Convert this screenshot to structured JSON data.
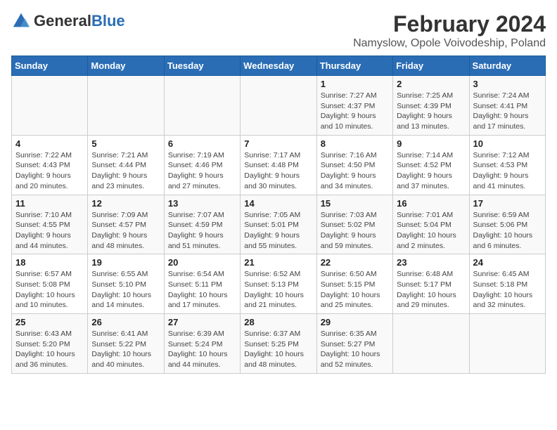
{
  "header": {
    "logo_general": "General",
    "logo_blue": "Blue",
    "title": "February 2024",
    "subtitle": "Namyslow, Opole Voivodeship, Poland"
  },
  "calendar": {
    "weekdays": [
      "Sunday",
      "Monday",
      "Tuesday",
      "Wednesday",
      "Thursday",
      "Friday",
      "Saturday"
    ],
    "weeks": [
      [
        {
          "day": "",
          "info": ""
        },
        {
          "day": "",
          "info": ""
        },
        {
          "day": "",
          "info": ""
        },
        {
          "day": "",
          "info": ""
        },
        {
          "day": "1",
          "info": "Sunrise: 7:27 AM\nSunset: 4:37 PM\nDaylight: 9 hours\nand 10 minutes."
        },
        {
          "day": "2",
          "info": "Sunrise: 7:25 AM\nSunset: 4:39 PM\nDaylight: 9 hours\nand 13 minutes."
        },
        {
          "day": "3",
          "info": "Sunrise: 7:24 AM\nSunset: 4:41 PM\nDaylight: 9 hours\nand 17 minutes."
        }
      ],
      [
        {
          "day": "4",
          "info": "Sunrise: 7:22 AM\nSunset: 4:43 PM\nDaylight: 9 hours\nand 20 minutes."
        },
        {
          "day": "5",
          "info": "Sunrise: 7:21 AM\nSunset: 4:44 PM\nDaylight: 9 hours\nand 23 minutes."
        },
        {
          "day": "6",
          "info": "Sunrise: 7:19 AM\nSunset: 4:46 PM\nDaylight: 9 hours\nand 27 minutes."
        },
        {
          "day": "7",
          "info": "Sunrise: 7:17 AM\nSunset: 4:48 PM\nDaylight: 9 hours\nand 30 minutes."
        },
        {
          "day": "8",
          "info": "Sunrise: 7:16 AM\nSunset: 4:50 PM\nDaylight: 9 hours\nand 34 minutes."
        },
        {
          "day": "9",
          "info": "Sunrise: 7:14 AM\nSunset: 4:52 PM\nDaylight: 9 hours\nand 37 minutes."
        },
        {
          "day": "10",
          "info": "Sunrise: 7:12 AM\nSunset: 4:53 PM\nDaylight: 9 hours\nand 41 minutes."
        }
      ],
      [
        {
          "day": "11",
          "info": "Sunrise: 7:10 AM\nSunset: 4:55 PM\nDaylight: 9 hours\nand 44 minutes."
        },
        {
          "day": "12",
          "info": "Sunrise: 7:09 AM\nSunset: 4:57 PM\nDaylight: 9 hours\nand 48 minutes."
        },
        {
          "day": "13",
          "info": "Sunrise: 7:07 AM\nSunset: 4:59 PM\nDaylight: 9 hours\nand 51 minutes."
        },
        {
          "day": "14",
          "info": "Sunrise: 7:05 AM\nSunset: 5:01 PM\nDaylight: 9 hours\nand 55 minutes."
        },
        {
          "day": "15",
          "info": "Sunrise: 7:03 AM\nSunset: 5:02 PM\nDaylight: 9 hours\nand 59 minutes."
        },
        {
          "day": "16",
          "info": "Sunrise: 7:01 AM\nSunset: 5:04 PM\nDaylight: 10 hours\nand 2 minutes."
        },
        {
          "day": "17",
          "info": "Sunrise: 6:59 AM\nSunset: 5:06 PM\nDaylight: 10 hours\nand 6 minutes."
        }
      ],
      [
        {
          "day": "18",
          "info": "Sunrise: 6:57 AM\nSunset: 5:08 PM\nDaylight: 10 hours\nand 10 minutes."
        },
        {
          "day": "19",
          "info": "Sunrise: 6:55 AM\nSunset: 5:10 PM\nDaylight: 10 hours\nand 14 minutes."
        },
        {
          "day": "20",
          "info": "Sunrise: 6:54 AM\nSunset: 5:11 PM\nDaylight: 10 hours\nand 17 minutes."
        },
        {
          "day": "21",
          "info": "Sunrise: 6:52 AM\nSunset: 5:13 PM\nDaylight: 10 hours\nand 21 minutes."
        },
        {
          "day": "22",
          "info": "Sunrise: 6:50 AM\nSunset: 5:15 PM\nDaylight: 10 hours\nand 25 minutes."
        },
        {
          "day": "23",
          "info": "Sunrise: 6:48 AM\nSunset: 5:17 PM\nDaylight: 10 hours\nand 29 minutes."
        },
        {
          "day": "24",
          "info": "Sunrise: 6:45 AM\nSunset: 5:18 PM\nDaylight: 10 hours\nand 32 minutes."
        }
      ],
      [
        {
          "day": "25",
          "info": "Sunrise: 6:43 AM\nSunset: 5:20 PM\nDaylight: 10 hours\nand 36 minutes."
        },
        {
          "day": "26",
          "info": "Sunrise: 6:41 AM\nSunset: 5:22 PM\nDaylight: 10 hours\nand 40 minutes."
        },
        {
          "day": "27",
          "info": "Sunrise: 6:39 AM\nSunset: 5:24 PM\nDaylight: 10 hours\nand 44 minutes."
        },
        {
          "day": "28",
          "info": "Sunrise: 6:37 AM\nSunset: 5:25 PM\nDaylight: 10 hours\nand 48 minutes."
        },
        {
          "day": "29",
          "info": "Sunrise: 6:35 AM\nSunset: 5:27 PM\nDaylight: 10 hours\nand 52 minutes."
        },
        {
          "day": "",
          "info": ""
        },
        {
          "day": "",
          "info": ""
        }
      ]
    ]
  }
}
